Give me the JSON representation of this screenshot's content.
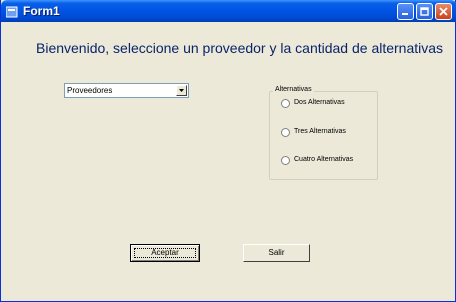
{
  "window": {
    "title": "Form1"
  },
  "form": {
    "heading": "Bienvenido, seleccione un proveedor y la cantidad de alternativas",
    "provider_select": {
      "value": "Proveedores"
    },
    "alternatives_group": {
      "label": "Alternativas",
      "options": [
        "Dos Alternativas",
        "Tres Alternativas",
        "Cuatro Alternativas"
      ]
    },
    "buttons": {
      "accept": "Aceptar",
      "exit": "Salir"
    }
  }
}
